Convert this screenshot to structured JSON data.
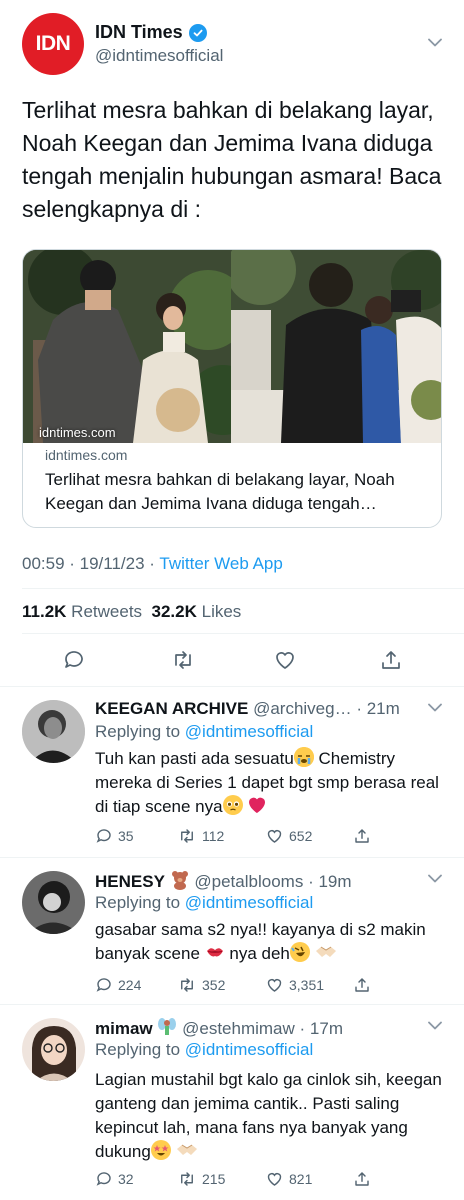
{
  "main_tweet": {
    "avatar_text": "IDN",
    "author_name": "IDN Times",
    "author_handle": "@idntimesofficial",
    "text": "Terlihat mesra bahkan di belakang layar, Noah Keegan dan Jemima Ivana diduga tengah menjalin hubungan asmara! Baca selengkapnya di :",
    "card": {
      "image_domain_tag": "idntimes.com",
      "domain": "idntimes.com",
      "title": "Terlihat mesra bahkan di belakang layar, Noah Keegan dan Jemima Ivana diduga tengah…"
    },
    "timestamp": "00:59 · 19/11/23 · ",
    "app": "Twitter Web App",
    "retweets_count": "11.2K",
    "retweets_label": "Retweets",
    "likes_count": "32.2K",
    "likes_label": "Likes"
  },
  "replies": [
    {
      "name": "KEEGAN ARCHIVE",
      "handle": "@archiveg…",
      "time": "· 21m",
      "replying_label": "Replying to ",
      "replying_to": "@idntimesofficial",
      "text_1": "Tuh kan pasti ada sesuatu",
      "text_2": " Chemistry mereka di Series 1 dapet bgt smp berasa real di tiap scene nya",
      "replies_count": "35",
      "retweets_count": "112",
      "likes_count": "652"
    },
    {
      "name": "HENESY",
      "handle": "@petalblooms",
      "time": "· 19m",
      "replying_label": "Replying to ",
      "replying_to": "@idntimesofficial",
      "text_1": "gasabar sama s2 nya!! kayanya di s2 makin banyak scene ",
      "text_2": " nya deh",
      "replies_count": "224",
      "retweets_count": "352",
      "likes_count": "3,351"
    },
    {
      "name": "mimaw",
      "handle": "@estehmimaw",
      "time": "· 17m",
      "replying_label": "Replying to ",
      "replying_to": "@idntimesofficial",
      "text_1": "Lagian mustahil bgt kalo ga cinlok sih, keegan ganteng dan jemima cantik.. Pasti saling kepincut lah, mana fans nya banyak yang dukung",
      "replies_count": "32",
      "retweets_count": "215",
      "likes_count": "821"
    }
  ],
  "colors": {
    "accent": "#1d9bf0",
    "brand_red": "#e11d26",
    "secondary_text": "#536471",
    "like_red": "#e0245e"
  }
}
